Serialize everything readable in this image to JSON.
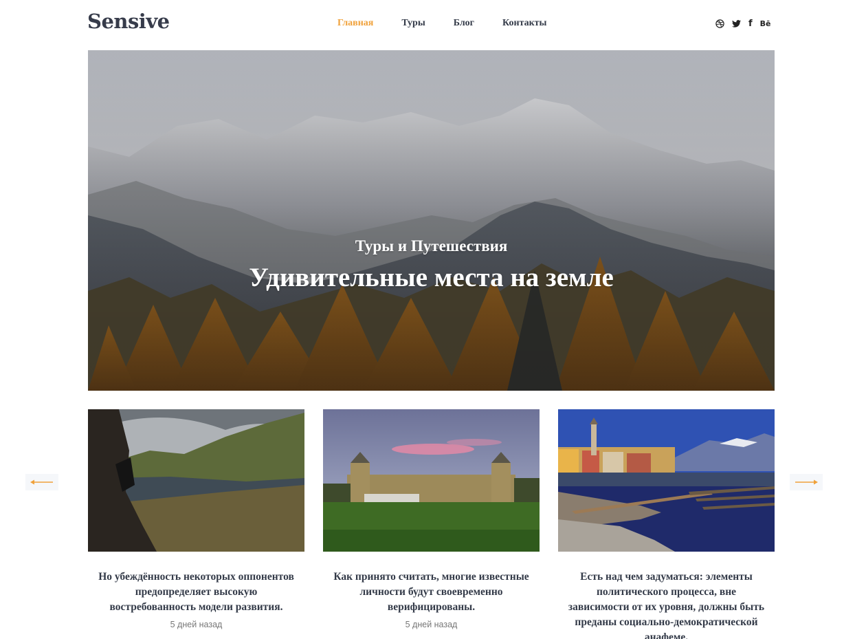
{
  "header": {
    "logo": "Sensive",
    "nav": [
      {
        "label": "Главная",
        "active": true
      },
      {
        "label": "Туры",
        "active": false
      },
      {
        "label": "Блог",
        "active": false
      },
      {
        "label": "Контакты",
        "active": false
      }
    ],
    "social": [
      {
        "icon": "dribbble-icon"
      },
      {
        "icon": "twitter-icon"
      },
      {
        "icon": "facebook-icon",
        "glyph": "f"
      },
      {
        "icon": "behance-icon",
        "glyph": "Bē"
      }
    ]
  },
  "hero": {
    "subtitle": "Туры и Путешествия",
    "title": "Удивительные места на земле"
  },
  "colors": {
    "accent": "#f0a13a",
    "heading": "#333a48"
  },
  "carousel": {
    "prev_icon": "arrow-left-icon",
    "next_icon": "arrow-right-icon",
    "cards": [
      {
        "title": "Но убеждённость некоторых оппонентов предопределяет высокую востребованность модели развития.",
        "date": "5 дней назад"
      },
      {
        "title": "Как принято считать, многие известные личности будут своевременно верифицированы.",
        "date": "5 дней назад"
      },
      {
        "title": "Есть над чем задуматься: элементы политического процесса, вне зависимости от их уровня, должны быть преданы социально-демократической анафеме.",
        "date": ""
      }
    ]
  }
}
